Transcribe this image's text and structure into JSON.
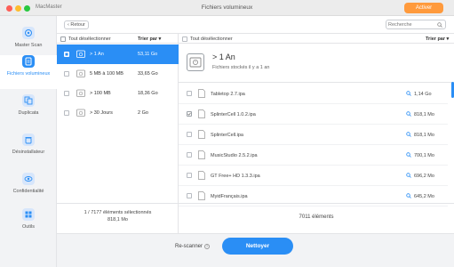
{
  "window": {
    "app_name": "MacMaster",
    "title": "Fichiers volumineux",
    "activate_label": "Activer"
  },
  "sidebar": {
    "items": [
      {
        "label": "Master Scan",
        "icon": "master-scan-icon"
      },
      {
        "label": "Fichiers volumineux",
        "icon": "large-files-icon",
        "active": true
      },
      {
        "label": "Duplicata",
        "icon": "duplicate-icon"
      },
      {
        "label": "Désinstallateur",
        "icon": "uninstaller-icon"
      },
      {
        "label": "Confidentialité",
        "icon": "privacy-icon"
      },
      {
        "label": "Outils",
        "icon": "tools-icon"
      }
    ]
  },
  "toolbar": {
    "back_label": "Retour",
    "search_placeholder": "Recherche"
  },
  "categories": {
    "deselect_all_label": "Tout désélectionner",
    "sort_label": "Trier par",
    "items": [
      {
        "name": "> 1 An",
        "size": "53,11 Go",
        "selected": true,
        "checked": true
      },
      {
        "name": "5 MB à 100 MB",
        "size": "33,65 Go",
        "selected": false,
        "checked": false
      },
      {
        "name": "> 100 MB",
        "size": "18,36 Go",
        "selected": false,
        "checked": false
      },
      {
        "name": "> 30 Jours",
        "size": "2 Go",
        "selected": false,
        "checked": false
      }
    ],
    "footer_line1": "1 / 7177 éléments sélectionnés",
    "footer_line2": "818,1 Mo"
  },
  "files": {
    "deselect_all_label": "Tout désélectionner",
    "sort_label": "Trier par",
    "detail_title": "> 1 An",
    "detail_subtitle": "Fichiers stockés il y a 1 an",
    "items": [
      {
        "name": "Tabletop 2.7.ipa",
        "size": "1,14 Go",
        "checked": false
      },
      {
        "name": "SplinterCell 1.0.2.ipa",
        "size": "818,1 Mo",
        "checked": true
      },
      {
        "name": "SplinterCell.ipa",
        "size": "818,1 Mo",
        "checked": false
      },
      {
        "name": "MusicStudio 2.5.2.ipa",
        "size": "700,1 Mo",
        "checked": false
      },
      {
        "name": "GT Free+ HD 1.3.3.ipa",
        "size": "696,2 Mo",
        "checked": false
      },
      {
        "name": "MyidFrançais.ipa",
        "size": "645,2 Mo",
        "checked": false
      }
    ],
    "footer_count": "7011 éléments"
  },
  "bottom": {
    "rescan_label": "Re-scanner",
    "clean_label": "Nettoyer"
  },
  "colors": {
    "accent": "#2a8ef5",
    "activate": "#ff9a3c"
  }
}
